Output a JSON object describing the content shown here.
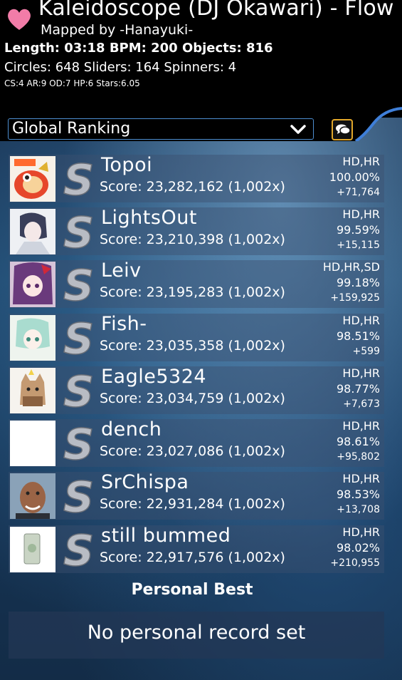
{
  "header": {
    "song_title": "Kaleidoscope (DJ Okawari) - Flow",
    "mapper": "Mapped by -Hanayuki-",
    "stats_line1": "Length: 03:18 BPM: 200 Objects: 816",
    "stats_line2": "Circles: 648 Sliders: 164 Spinners: 4",
    "stats_line3": "CS:4 AR:9 OD:7 HP:6 Stars:6.05",
    "heart_color": "#f27ca8"
  },
  "ranking_dropdown": {
    "selected": "Global Ranking"
  },
  "chat_button": {
    "icon": "chat-bubbles-icon",
    "border_color": "#e1a629"
  },
  "scores": [
    {
      "rank": 1,
      "name": "Topoi",
      "score": "Score: 23,282,162 (1,002x)",
      "mods": "HD,HR",
      "accuracy": "100.00%",
      "diff": "+71,764",
      "grade": "S",
      "avatar": "topoi-fish"
    },
    {
      "rank": 2,
      "name": "LightsOut",
      "score": "Score: 23,210,398 (1,002x)",
      "mods": "HD,HR",
      "accuracy": "99.59%",
      "diff": "+15,115",
      "grade": "S",
      "avatar": "lightsout-sketch"
    },
    {
      "rank": 3,
      "name": "Leiv",
      "score": "Score: 23,195,283 (1,002x)",
      "mods": "HD,HR,SD",
      "accuracy": "99.18%",
      "diff": "+159,925",
      "grade": "S",
      "avatar": "leiv-anime"
    },
    {
      "rank": 4,
      "name": "Fish-",
      "score": "Score: 23,035,358 (1,002x)",
      "mods": "HD,HR",
      "accuracy": "98.51%",
      "diff": "+599",
      "grade": "S",
      "avatar": "fish-anime"
    },
    {
      "rank": 5,
      "name": "Eagle5324",
      "score": "Score: 23,034,759 (1,002x)",
      "mods": "HD,HR",
      "accuracy": "98.77%",
      "diff": "+7,673",
      "grade": "S",
      "avatar": "eagle-cat"
    },
    {
      "rank": 6,
      "name": "dench",
      "score": "Score: 23,027,086 (1,002x)",
      "mods": "HD,HR",
      "accuracy": "98.61%",
      "diff": "+95,802",
      "grade": "S",
      "avatar": "dench-blank"
    },
    {
      "rank": 7,
      "name": "SrChispa",
      "score": "Score: 22,931,284 (1,002x)",
      "mods": "HD,HR",
      "accuracy": "98.53%",
      "diff": "+13,708",
      "grade": "S",
      "avatar": "srchispa-face"
    },
    {
      "rank": 8,
      "name": "still bummed",
      "score": "Score: 22,917,576 (1,002x)",
      "mods": "HD,HR",
      "accuracy": "98.02%",
      "diff": "+210,955",
      "grade": "S",
      "avatar": "still-bummed-item"
    }
  ],
  "personal_best": {
    "title": "Personal Best",
    "message": "No personal record set"
  }
}
